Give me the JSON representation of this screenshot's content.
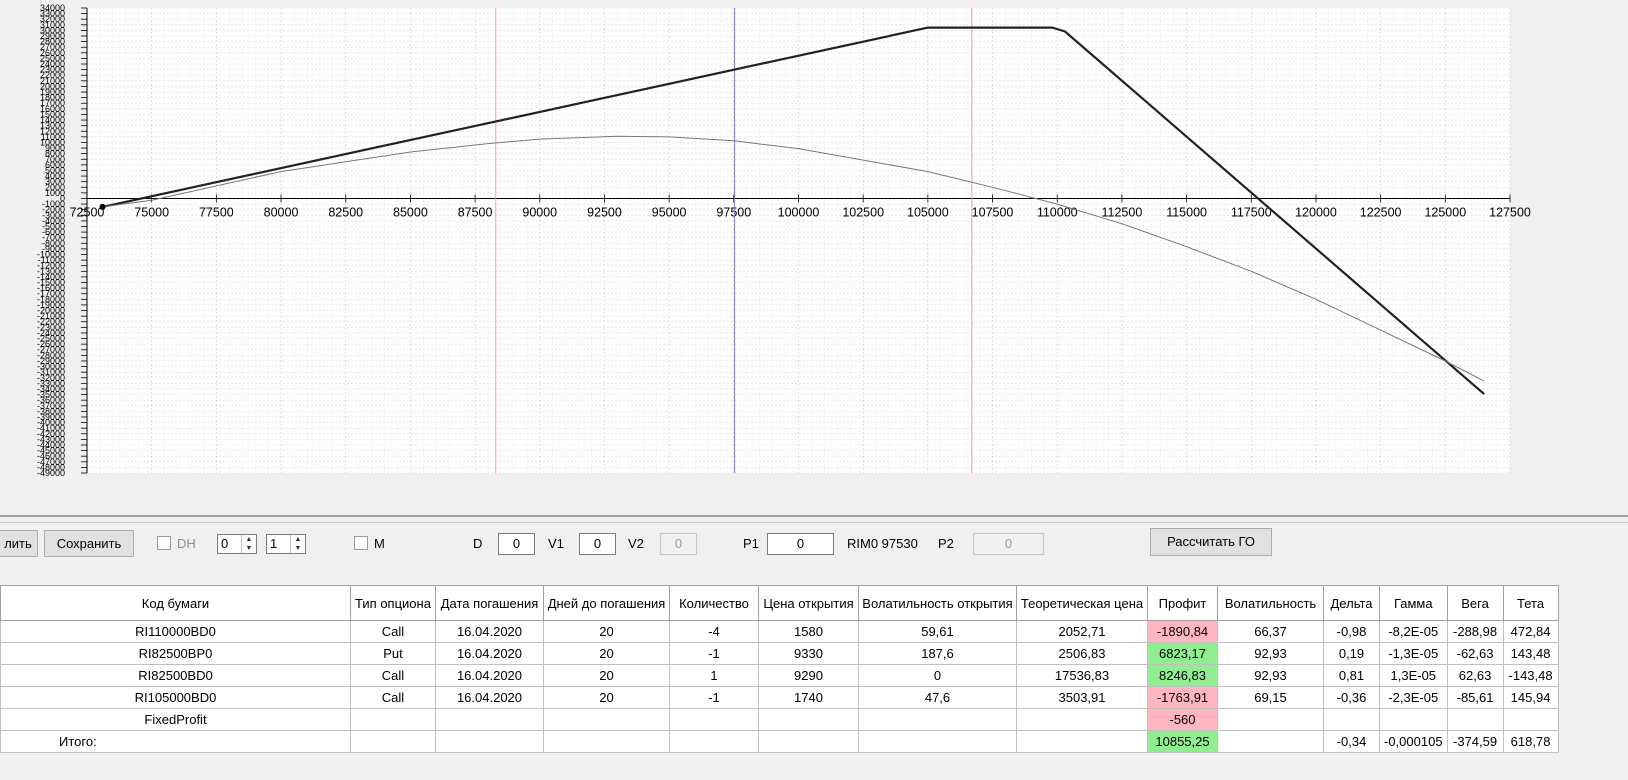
{
  "chart_data": {
    "type": "line",
    "title": "",
    "xlim": [
      72500,
      127500
    ],
    "ylim": [
      -49000,
      34000
    ],
    "x_ticks": [
      72500,
      75000,
      77500,
      80000,
      82500,
      85000,
      87500,
      90000,
      92500,
      95000,
      97500,
      100000,
      102500,
      105000,
      107500,
      110000,
      112500,
      115000,
      117500,
      120000,
      122500,
      125000,
      127500
    ],
    "y_ticks_major_step": 1000,
    "grid": true,
    "vertical_markers": [
      {
        "x": 88300,
        "color": "#ff9999"
      },
      {
        "x": 97530,
        "color": "#8080b0"
      },
      {
        "x": 106700,
        "color": "#ff9999"
      }
    ],
    "series": [
      {
        "line_color": "#222222",
        "width": 2.2,
        "x": [
          73100,
          105000,
          109800,
          110300,
          126500
        ],
        "y": [
          -1500,
          30500,
          30500,
          29800,
          -34900
        ]
      },
      {
        "line_color": "#777777",
        "width": 1,
        "x": [
          73100,
          75000,
          80000,
          85000,
          88000,
          90000,
          93000,
          95000,
          97500,
          100000,
          105000,
          107500,
          110000,
          112500,
          115000,
          117500,
          120000,
          122500,
          125000,
          126500
        ],
        "y": [
          -1500,
          -300,
          4800,
          8300,
          9800,
          10600,
          11100,
          11000,
          10300,
          8900,
          4800,
          2000,
          -1000,
          -4500,
          -8600,
          -13000,
          -18000,
          -23500,
          -29000,
          -32600
        ]
      }
    ]
  },
  "toolbar": {
    "delete_label": "лить",
    "save_label": "Сохранить",
    "dh_label": "DH",
    "spin1_value": "0",
    "spin2_value": "1",
    "m_label": "M",
    "d_label": "D",
    "d_value": "0",
    "v1_label": "V1",
    "v1_value": "0",
    "v2_label": "V2",
    "v2_value": "0",
    "p1_label": "P1",
    "p1_value": "0",
    "instrument_text": "RIM0 97530",
    "p2_label": "P2",
    "p2_value": "0",
    "calc_label": "Рассчитать ГО"
  },
  "table": {
    "headers": [
      "Код бумаги",
      "Тип опциона",
      "Дата погашения",
      "Дней до погашения",
      "Количество",
      "Цена открытия",
      "Волатильность открытия",
      "Теоретическая цена",
      "Профит",
      "Волатильность",
      "Дельта",
      "Гамма",
      "Вега",
      "Тета"
    ],
    "rows": [
      [
        "RI110000BD0",
        "Call",
        "16.04.2020",
        "20",
        "-4",
        "1580",
        "59,61",
        "2052,71",
        "-1890,84",
        "66,37",
        "-0,98",
        "-8,2E-05",
        "-288,98",
        "472,84"
      ],
      [
        "RI82500BP0",
        "Put",
        "16.04.2020",
        "20",
        "-1",
        "9330",
        "187,6",
        "2506,83",
        "6823,17",
        "92,93",
        "0,19",
        "-1,3E-05",
        "-62,63",
        "143,48"
      ],
      [
        "RI82500BD0",
        "Call",
        "16.04.2020",
        "20",
        "1",
        "9290",
        "0",
        "17536,83",
        "8246,83",
        "92,93",
        "0,81",
        "1,3E-05",
        "62,63",
        "-143,48"
      ],
      [
        "RI105000BD0",
        "Call",
        "16.04.2020",
        "20",
        "-1",
        "1740",
        "47,6",
        "3503,91",
        "-1763,91",
        "69,15",
        "-0,36",
        "-2,3E-05",
        "-85,61",
        "145,94"
      ],
      [
        "FixedProfit",
        "",
        "",
        "",
        "",
        "",
        "",
        "",
        "-560",
        "",
        "",
        "",
        "",
        ""
      ],
      [
        "Итого:",
        "",
        "",
        "",
        "",
        "",
        "",
        "",
        "10855,25",
        "",
        "-0,34",
        "-0,000105",
        "-374,59",
        "618,78"
      ]
    ],
    "profit_status": [
      "neg",
      "pos",
      "pos",
      "neg",
      "neg",
      "pos"
    ],
    "colors": {
      "positive": "#90ee90",
      "negative": "#ffb6c1"
    }
  }
}
